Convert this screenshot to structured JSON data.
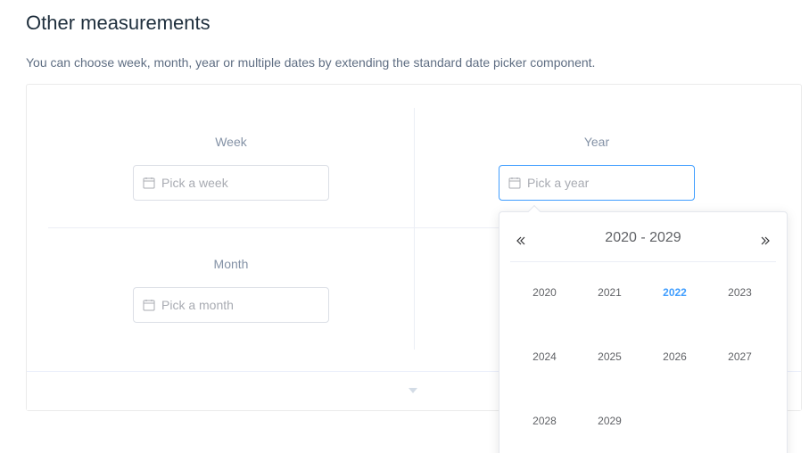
{
  "section": {
    "title": "Other measurements",
    "description": "You can choose week, month, year or multiple dates by extending the standard date picker component."
  },
  "pickers": {
    "week": {
      "label": "Week",
      "placeholder": "Pick a week"
    },
    "year": {
      "label": "Year",
      "placeholder": "Pick a year"
    },
    "month": {
      "label": "Month",
      "placeholder": "Pick a month"
    }
  },
  "year_popup": {
    "range": "2020 - 2029",
    "prev_icon": "double-chevron-left-icon",
    "next_icon": "double-chevron-right-icon",
    "years": [
      "2020",
      "2021",
      "2022",
      "2023",
      "2024",
      "2025",
      "2026",
      "2027",
      "2028",
      "2029"
    ],
    "current_year": "2022"
  },
  "colors": {
    "accent": "#409eff",
    "border": "#dcdfe6",
    "placeholder": "#a8abb2",
    "label": "#8492a6"
  }
}
